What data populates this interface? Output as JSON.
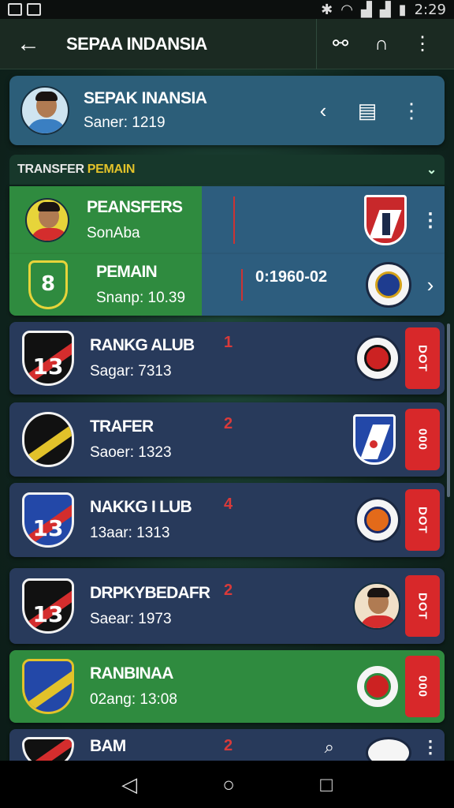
{
  "status_bar": {
    "time": "2:29"
  },
  "app_bar": {
    "title": "SEPAA INDANSIA",
    "back_icon": "arrow-left-icon",
    "actions": [
      "share-icon",
      "headset-icon",
      "more-vert-icon"
    ]
  },
  "profile": {
    "name": "SEPAK INANSIA",
    "subtitle": "Saner: 1219"
  },
  "section": {
    "title_white": "TRANSFER",
    "title_yellow": "PEMAIN"
  },
  "rows": [
    {
      "name": "PEANSFERS",
      "sub": "SonAba",
      "rank": "",
      "mid": ""
    },
    {
      "name": "PEMAIN",
      "sub": "Snanp: 10.39",
      "rank": "",
      "mid": "0:1960-02"
    },
    {
      "name": "RANKG ALUB",
      "sub": "Sagar: 7313",
      "rank": "1",
      "mid": "",
      "tag": "DOT"
    },
    {
      "name": "TRAFER",
      "sub": "Saoer: 1323",
      "rank": "2",
      "mid": "",
      "tag": "000"
    },
    {
      "name": "NAKKG I LUB",
      "sub": "13aar: 1313",
      "rank": "4",
      "mid": "",
      "tag": "DOT"
    },
    {
      "name": "DRPKYBEDAFR",
      "sub": "Saear: 1973",
      "rank": "2",
      "mid": "",
      "tag": "DOT"
    },
    {
      "name": "RANBINAA",
      "sub": "02ang: 13:08",
      "rank": "",
      "mid": "",
      "tag": "000"
    },
    {
      "name": "BAM",
      "sub": "",
      "rank": "2",
      "mid": ""
    }
  ],
  "colors": {
    "green": "#2f8b3f",
    "blue": "#283a5b",
    "accent_red": "#d8282a",
    "yellow": "#e2c22a"
  }
}
